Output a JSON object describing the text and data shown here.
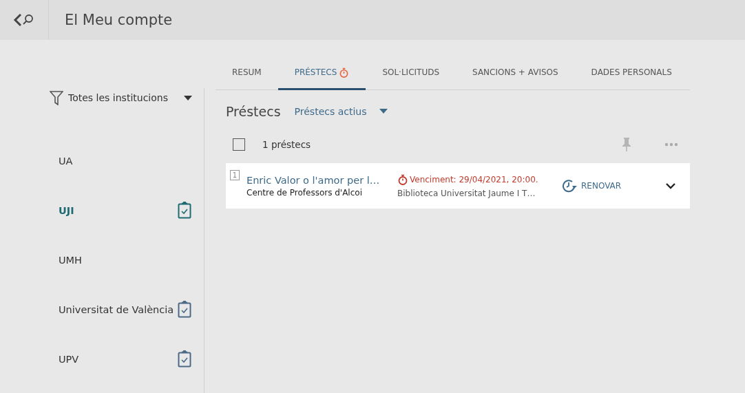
{
  "header": {
    "title": "El Meu compte"
  },
  "sidebar": {
    "filter": "Totes les institucions",
    "items": [
      {
        "label": "UA",
        "selected": false,
        "has_icon": false
      },
      {
        "label": "UJI",
        "selected": true,
        "has_icon": true
      },
      {
        "label": "UMH",
        "selected": false,
        "has_icon": false
      },
      {
        "label": "Universitat de València",
        "selected": false,
        "has_icon": true
      },
      {
        "label": "UPV",
        "selected": false,
        "has_icon": true
      }
    ]
  },
  "tabs": [
    {
      "label": "RESUM",
      "selected": false,
      "alert": false
    },
    {
      "label": "PRÉSTECS",
      "selected": true,
      "alert": true
    },
    {
      "label": "SOL·LICITUDS",
      "selected": false,
      "alert": false
    },
    {
      "label": "SANCIONS + AVISOS",
      "selected": false,
      "alert": false
    },
    {
      "label": "DADES PERSONALS",
      "selected": false,
      "alert": false
    }
  ],
  "section": {
    "title": "Préstecs",
    "filter": "Préstecs actius",
    "count": "1 préstecs",
    "select_all": {
      "checked": false
    }
  },
  "loans": [
    {
      "number": "1",
      "title": "Enric Valor o l'amor per l…",
      "author": "Centre de Professors d'Alcoi",
      "due": "Venciment: 29/04/2021, 20:00.",
      "overdue": true,
      "library": "Biblioteca Universitat Jaume I T…",
      "action": "RENOVAR"
    }
  ]
}
